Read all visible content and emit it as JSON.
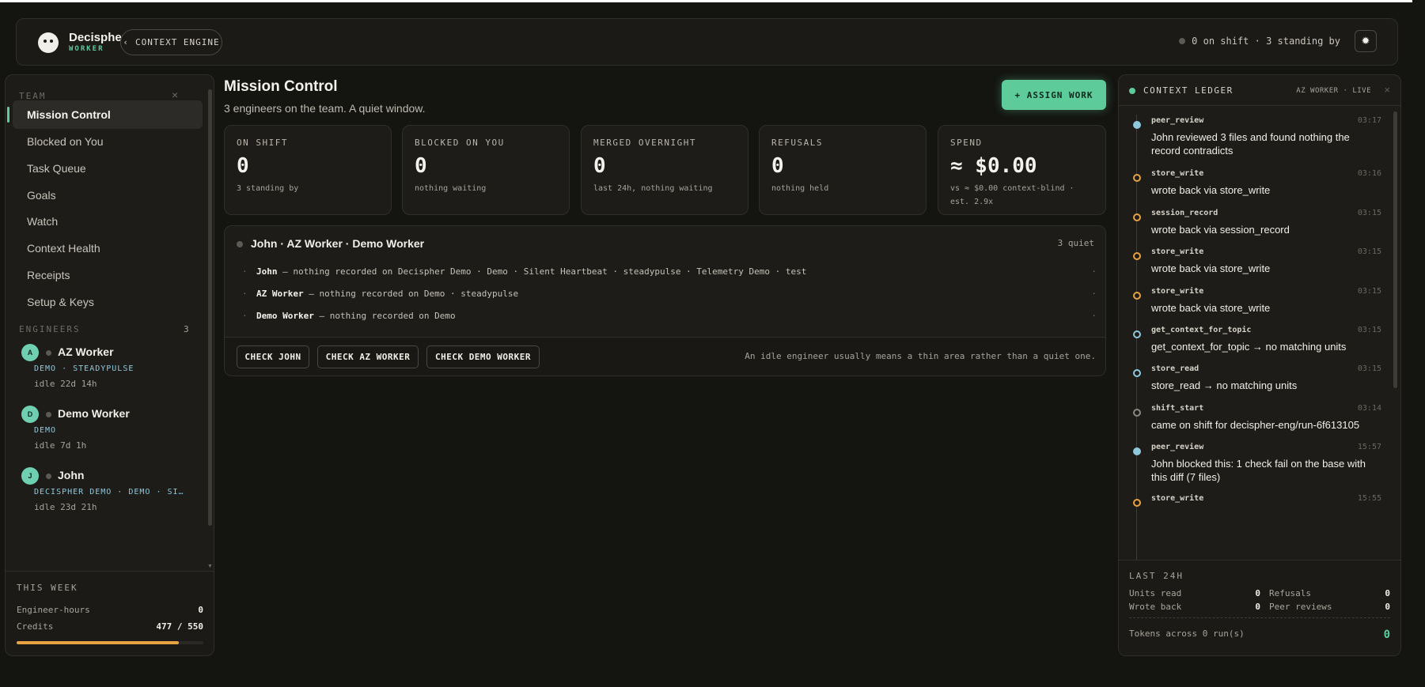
{
  "header": {
    "brand": "Decispher",
    "brand_sub": "WORKER",
    "context_button": "CONTEXT ENGINE",
    "shift_status": "0 on shift · 3 standing by",
    "theme_icon": "sun-icon"
  },
  "sidebar": {
    "team_label": "TEAM",
    "nav": [
      {
        "label": "Mission Control",
        "active": true
      },
      {
        "label": "Blocked on You"
      },
      {
        "label": "Task Queue"
      },
      {
        "label": "Goals"
      },
      {
        "label": "Watch"
      },
      {
        "label": "Context Health"
      },
      {
        "label": "Receipts"
      },
      {
        "label": "Setup & Keys"
      }
    ],
    "engineers_label": "ENGINEERS",
    "engineers_count": "3",
    "engineers": [
      {
        "initial": "A",
        "name": "AZ Worker",
        "tags": "DEMO · STEADYPULSE",
        "idle": "idle 22d 14h"
      },
      {
        "initial": "D",
        "name": "Demo Worker",
        "tags": "DEMO",
        "idle": "idle 7d 1h"
      },
      {
        "initial": "J",
        "name": "John",
        "tags": "DECISPHER DEMO · DEMO · SILENT…",
        "idle": "idle 23d 21h"
      }
    ],
    "week": {
      "label": "THIS WEEK",
      "hours_label": "Engineer-hours",
      "hours_value": "0",
      "credits_label": "Credits",
      "credits_value": "477 / 550",
      "credits_used": 477,
      "credits_total": 550,
      "bar_color": "#e8a244"
    }
  },
  "main": {
    "title": "Mission Control",
    "subtitle": "3 engineers on the team. A quiet window.",
    "assign_button": "+ ASSIGN WORK",
    "accent": "#5ecb9b",
    "stats": [
      {
        "label": "ON SHIFT",
        "value": "0",
        "note": "3 standing by"
      },
      {
        "label": "BLOCKED ON YOU",
        "value": "0",
        "note": "nothing waiting"
      },
      {
        "label": "MERGED OVERNIGHT",
        "value": "0",
        "note": "last 24h, nothing waiting"
      },
      {
        "label": "REFUSALS",
        "value": "0",
        "note": "nothing held"
      },
      {
        "label": "SPEND",
        "value": "≈ $0.00",
        "note": "vs ≈ $0.00 context-blind · est. 2.9x"
      }
    ],
    "group": {
      "title": "John · AZ Worker · Demo Worker",
      "count": "3 quiet",
      "rows": [
        {
          "name": "John",
          "text": " — nothing recorded on Decispher Demo · Demo · Silent Heartbeat · steadypulse · Telemetry Demo · test"
        },
        {
          "name": "AZ Worker",
          "text": " — nothing recorded on Demo · steadypulse"
        },
        {
          "name": "Demo Worker",
          "text": " — nothing recorded on Demo"
        }
      ],
      "buttons": [
        "CHECK JOHN",
        "CHECK AZ WORKER",
        "CHECK DEMO WORKER"
      ],
      "note": "An idle engineer usually means a thin area rather than a quiet one."
    }
  },
  "ledger": {
    "title": "CONTEXT LEDGER",
    "meta": "AZ WORKER · LIVE",
    "events": [
      {
        "name": "peer_review",
        "time": "03:17",
        "text": "John reviewed 3 files and found nothing the record contradicts",
        "kind": "fill"
      },
      {
        "name": "store_write",
        "time": "03:16",
        "text": "wrote back via store_write",
        "kind": "orange"
      },
      {
        "name": "session_record",
        "time": "03:15",
        "text": "wrote back via session_record",
        "kind": "orange"
      },
      {
        "name": "store_write",
        "time": "03:15",
        "text": "wrote back via store_write",
        "kind": "orange"
      },
      {
        "name": "store_write",
        "time": "03:15",
        "text": "wrote back via store_write",
        "kind": "orange"
      },
      {
        "name": "get_context_for_topic",
        "time": "03:15",
        "text": "get_context_for_topic → no matching units",
        "kind": "blue"
      },
      {
        "name": "store_read",
        "time": "03:15",
        "text": "store_read → no matching units",
        "kind": "blue"
      },
      {
        "name": "shift_start",
        "time": "03:14",
        "text": "came on shift for decispher-eng/run-6f613105",
        "kind": "grey"
      },
      {
        "name": "peer_review",
        "time": "15:57",
        "text": "John blocked this: 1 check fail on the base with this diff (7 files)",
        "kind": "fill"
      },
      {
        "name": "store_write",
        "time": "15:55",
        "text": "",
        "kind": "orange"
      }
    ],
    "last24": {
      "label": "LAST 24H",
      "units_read_label": "Units read",
      "units_read": "0",
      "refusals_label": "Refusals",
      "refusals": "0",
      "wrote_back_label": "Wrote back",
      "wrote_back": "0",
      "peer_reviews_label": "Peer reviews",
      "peer_reviews": "0",
      "tokens_label": "Tokens across 0 run(s)",
      "tokens": "0"
    }
  }
}
